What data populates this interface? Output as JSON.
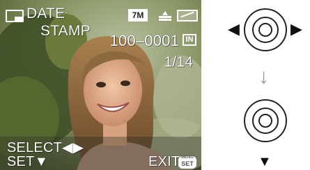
{
  "screen": {
    "title_line1": "DATE",
    "title_line2": "STAMP",
    "resolution_badge": "7M",
    "file_number": "100–0001",
    "card_label": "IN",
    "counter": "1/14"
  },
  "footer": {
    "select_label": "SELECT◀▶",
    "set_label": "SET▼",
    "exit_label": "EXIT",
    "set_badge_top": "MENU",
    "set_badge_label": "SET"
  },
  "controls": {
    "left_arrow": "◀",
    "right_arrow": "▶",
    "between_arrow": "↓",
    "down_arrow": "▼"
  },
  "colors": {
    "background": "#ffffff",
    "lcd_text": "#ffffff"
  }
}
